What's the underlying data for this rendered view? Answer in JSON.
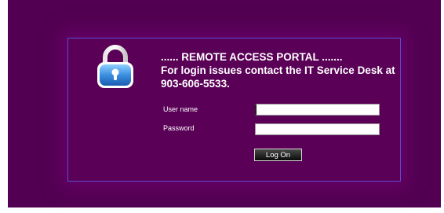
{
  "portal": {
    "title": "...... REMOTE ACCESS PORTAL .......",
    "info": "For login issues contact the IT Service Desk at 903-606-5533."
  },
  "form": {
    "username_label": "User name",
    "username_value": "",
    "password_label": "Password",
    "password_value": "",
    "logon_label": "Log On"
  },
  "icons": {
    "lock": "padlock-icon"
  },
  "colors": {
    "background": "#520052",
    "panel_border": "#5a4cd6",
    "text": "#ffffff"
  }
}
